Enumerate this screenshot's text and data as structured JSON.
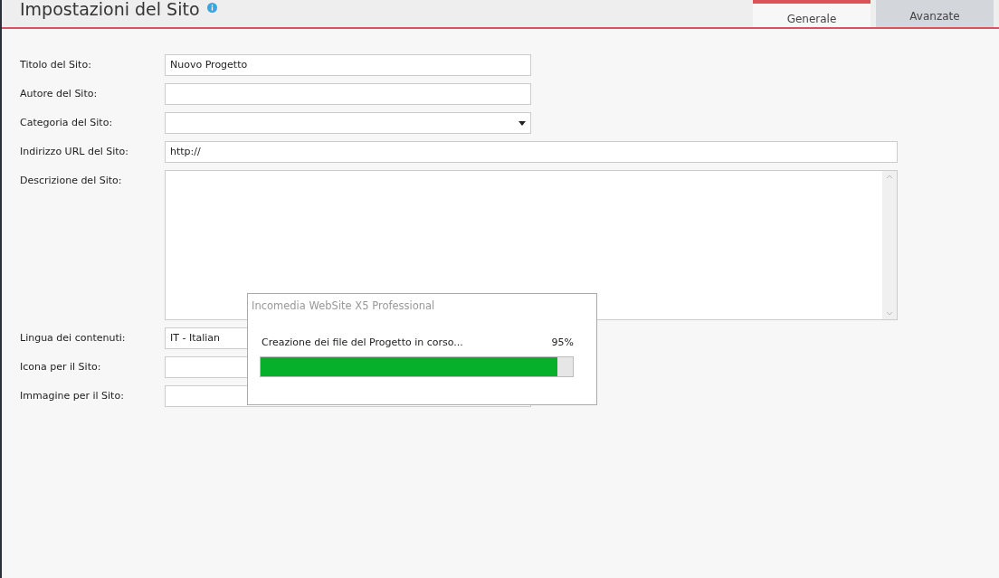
{
  "header": {
    "title": "Impostazioni del Sito"
  },
  "tabs": [
    {
      "label": "Generale",
      "selected": true
    },
    {
      "label": "Avanzate",
      "selected": false
    }
  ],
  "fields": [
    {
      "label": "Titolo del Sito:",
      "kind": "text",
      "value": "Nuovo Progetto"
    },
    {
      "label": "Autore del Sito:",
      "kind": "text"
    },
    {
      "label": "Categoria del Sito:",
      "kind": "select"
    },
    {
      "label": "Indirizzo URL del Sito:",
      "kind": "url",
      "value": "http://"
    },
    {
      "label": "Descrizione del Sito:",
      "kind": "textarea"
    },
    {
      "label": "Lingua dei contenuti:",
      "kind": "text",
      "value": "IT - Italian"
    },
    {
      "label": "Icona per il Sito:",
      "kind": "text"
    },
    {
      "label": "Immagine per il Sito:",
      "kind": "text"
    }
  ],
  "dialog": {
    "title": "Incomedia WebSite X5 Professional",
    "message": "Creazione dei file del Progetto in corso...",
    "percent": "95%",
    "level": 0.95
  }
}
